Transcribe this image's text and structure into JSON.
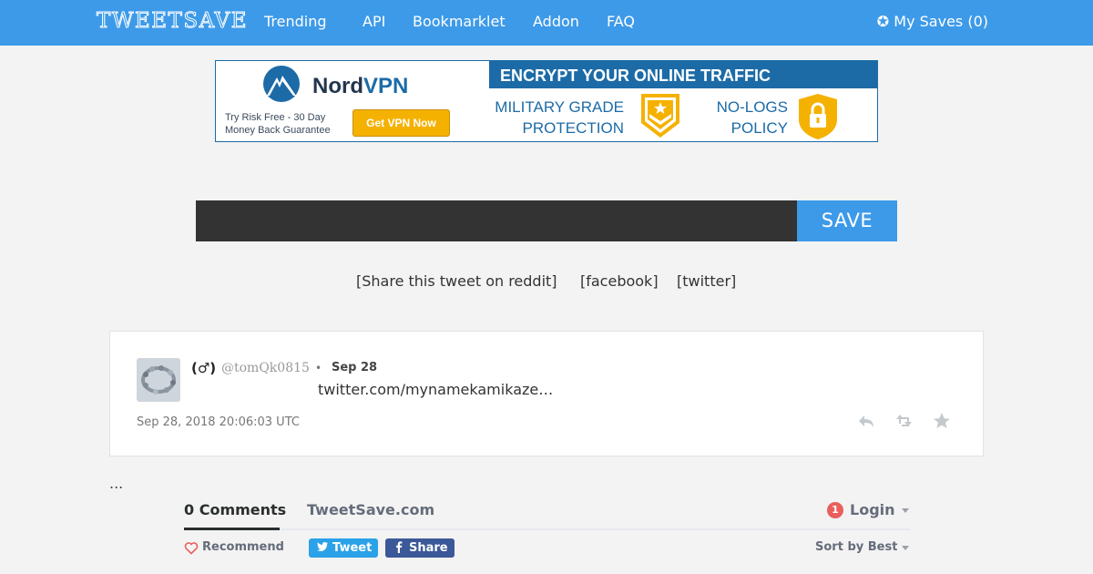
{
  "nav": {
    "logo": "TWEETSAVE",
    "links": [
      "Trending",
      "API",
      "Bookmarklet",
      "Addon",
      "FAQ"
    ],
    "saves_icon": "gear-icon",
    "saves_label": "✪ My Saves (0)",
    "background_color": "#3d9ae8"
  },
  "ad": {
    "brand_primary": "Nord",
    "brand_secondary": "VPN",
    "tagline": "Try Risk Free - 30 Day Money Back Guarantee",
    "cta": "Get VPN Now",
    "headline": "ENCRYPT YOUR ONLINE TRAFFIC",
    "feature_1": "MILITARY GRADE PROTECTION",
    "feature_2": "NO-LOGS POLICY"
  },
  "search": {
    "placeholder": "",
    "value": "",
    "button_label": "SAVE"
  },
  "share": {
    "reddit": "[Share this tweet on reddit]",
    "facebook": "[facebook]",
    "twitter": "[twitter]"
  },
  "tweet": {
    "name": "(♂)",
    "handle": "@tomQk0815",
    "separator": "•",
    "date": "Sep 28",
    "text": "twitter.com/mynamekamikaze…",
    "timestamp": "Sep 28, 2018 20:06:03 UTC",
    "actions": [
      "reply-icon",
      "retweet-icon",
      "favorite-icon"
    ]
  },
  "ellipsis": "...",
  "comments": {
    "tab_active": "0 Comments",
    "tab_site": "TweetSave.com",
    "notification_count": "1",
    "login": "Login",
    "recommend": "Recommend",
    "tweet_button": "Tweet",
    "share_button": "Share",
    "sort": "Sort by Best"
  }
}
